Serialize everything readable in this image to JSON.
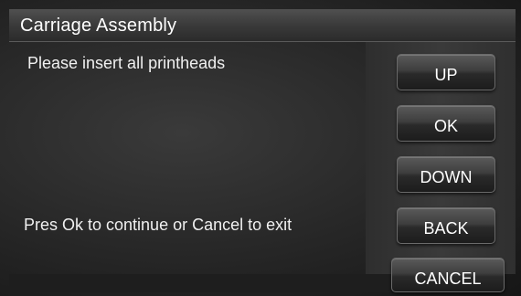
{
  "window": {
    "title": "Carriage Assembly"
  },
  "messages": {
    "instruction": "Please insert all printheads",
    "prompt": "Pres Ok to continue or Cancel to exit"
  },
  "buttons": {
    "up": "UP",
    "ok": "OK",
    "down": "DOWN",
    "back": "BACK",
    "cancel": "CANCEL"
  },
  "colors": {
    "background": "#262626",
    "text": "#ffffff"
  }
}
